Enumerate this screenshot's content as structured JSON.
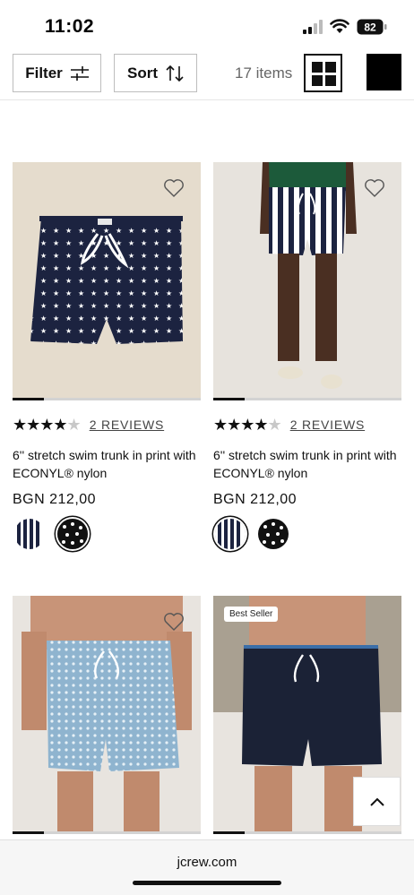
{
  "status_bar": {
    "time": "11:02",
    "battery": "82"
  },
  "toolbar": {
    "filter_label": "Filter",
    "sort_label": "Sort",
    "item_count": "17 items"
  },
  "products": [
    {
      "name": "6'' stretch swim trunk in print with ECONYL® nylon",
      "price": "BGN 212,00",
      "reviews": "2 REVIEWS",
      "rating": 4,
      "badge": ""
    },
    {
      "name": "6'' stretch swim trunk in print with ECONYL® nylon",
      "price": "BGN 212,00",
      "reviews": "2 REVIEWS",
      "rating": 4,
      "badge": ""
    },
    {
      "badge": ""
    },
    {
      "badge": "Best Seller"
    }
  ],
  "browser": {
    "url": "jcrew.com"
  },
  "colors": {
    "accent": "#111111",
    "navy": "#1c2340",
    "light_blue": "#8fb4cf"
  }
}
